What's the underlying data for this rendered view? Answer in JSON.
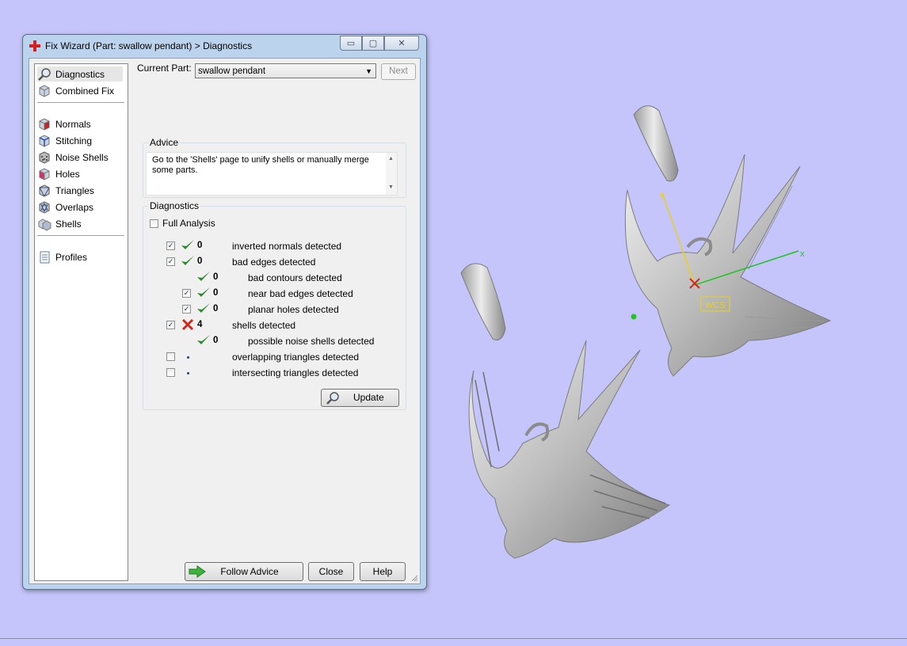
{
  "dialog": {
    "title": "Fix Wizard (Part: swallow pendant) > Diagnostics",
    "window_buttons": {
      "minimize": "▭",
      "maximize": "▢",
      "close": "✕"
    }
  },
  "nav": {
    "items": [
      {
        "label": "Diagnostics",
        "icon": "magnifier-icon",
        "selected": true
      },
      {
        "label": "Combined Fix",
        "icon": "cube-icon"
      },
      {
        "label": "Normals",
        "icon": "cube-red-face-icon"
      },
      {
        "label": "Stitching",
        "icon": "cube-blue-edge-icon"
      },
      {
        "label": "Noise Shells",
        "icon": "dotted-cube-icon"
      },
      {
        "label": "Holes",
        "icon": "cube-hole-icon"
      },
      {
        "label": "Triangles",
        "icon": "cube-triangles-icon"
      },
      {
        "label": "Overlaps",
        "icon": "cube-overlap-icon"
      },
      {
        "label": "Shells",
        "icon": "cube-shells-icon"
      },
      {
        "label": "Profiles",
        "icon": "document-icon"
      }
    ]
  },
  "current_part": {
    "label": "Current Part:",
    "value": "swallow pendant",
    "next_label": "Next"
  },
  "advice": {
    "title": "Advice",
    "text": "Go to the 'Shells' page to unify shells or manually merge some parts."
  },
  "diagnostics": {
    "title": "Diagnostics",
    "full_analysis_label": "Full Analysis",
    "rows": [
      {
        "checked": true,
        "status": "ok",
        "count": "0",
        "text": "inverted normals detected",
        "indent": 0
      },
      {
        "checked": true,
        "status": "ok",
        "count": "0",
        "text": "bad edges detected",
        "indent": 0
      },
      {
        "checked": null,
        "status": "ok",
        "count": "0",
        "text": "bad contours detected",
        "indent": 1
      },
      {
        "checked": true,
        "status": "ok",
        "count": "0",
        "text": "near bad edges detected",
        "indent": 1
      },
      {
        "checked": true,
        "status": "ok",
        "count": "0",
        "text": "planar holes detected",
        "indent": 1
      },
      {
        "checked": true,
        "status": "error",
        "count": "4",
        "text": "shells detected",
        "indent": 0
      },
      {
        "checked": null,
        "status": "ok",
        "count": "0",
        "text": "possible noise shells detected",
        "indent": 1
      },
      {
        "checked": false,
        "status": "none",
        "count": "",
        "text": "overlapping triangles detected",
        "indent": 0
      },
      {
        "checked": false,
        "status": "none",
        "count": "",
        "text": "intersecting triangles detected",
        "indent": 0
      }
    ],
    "update_label": "Update"
  },
  "footer": {
    "follow_advice_label": "Follow Advice",
    "close_label": "Close",
    "help_label": "Help"
  },
  "viewport": {
    "background_color": "#c5c5fb",
    "axis_labels": {
      "x": "x",
      "y": "y",
      "wcs": "WCS"
    }
  },
  "colors": {
    "ok": "#2b8a2b",
    "error": "#d0281e",
    "axis_x": "#22c322",
    "axis_y": "#e6d21f"
  }
}
